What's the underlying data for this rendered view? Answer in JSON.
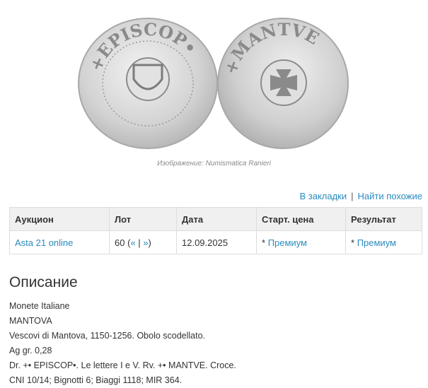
{
  "image": {
    "caption": "Изображение: Numismatica Ranieri",
    "obverse_legend": "+EPISCOP•",
    "reverse_legend": "+MANTVE"
  },
  "actions": {
    "bookmark": "В закладки",
    "separator": "|",
    "find_similar": "Найти похожие"
  },
  "table": {
    "headers": [
      "Аукцион",
      "Лот",
      "Дата",
      "Старт. цена",
      "Результат"
    ],
    "row": {
      "auction": "Asta 21 online",
      "lot_number": "60",
      "lot_open": "(",
      "lot_prev": "«",
      "lot_sep": "|",
      "lot_next": "»",
      "lot_close": ")",
      "date": "12.09.2025",
      "start_prefix": "*",
      "start_link": "Премиум",
      "result_prefix": "*",
      "result_link": "Премиум"
    }
  },
  "description": {
    "heading": "Описание",
    "lines": [
      "Monete Italiane",
      "MANTOVA",
      "Vescovi di Mantova, 1150-1256. Obolo scodellato.",
      "Ag gr. 0,28",
      "Dr. +• EPISCOP•. Le lettere I e V. Rv. +• MANTVE. Croce.",
      "CNI 10/14; Bignotti 6; Biaggi 1118; MIR 364."
    ]
  },
  "colors": {
    "link": "#2a8bbf",
    "header_bg": "#f0f0f0",
    "border": "#dddddd",
    "coin_silver": "#d7d7d7"
  }
}
